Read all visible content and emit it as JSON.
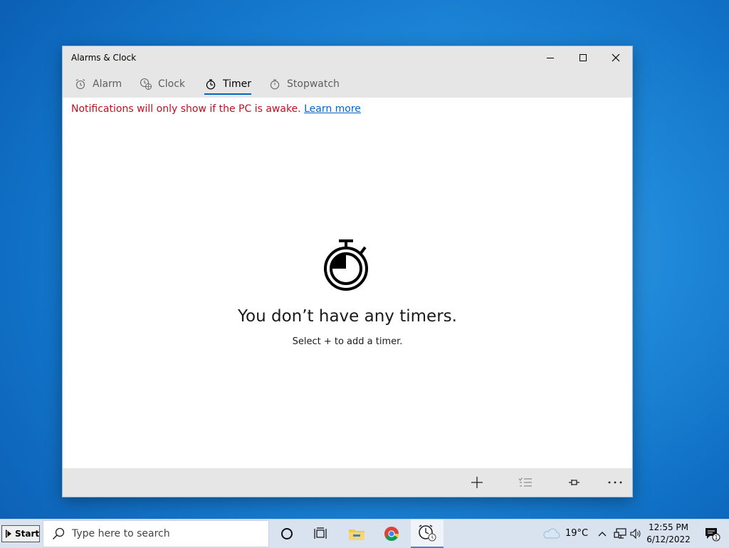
{
  "window": {
    "title": "Alarms & Clock"
  },
  "tabs": [
    {
      "label": "Alarm",
      "icon": "alarm-icon",
      "active": false
    },
    {
      "label": "Clock",
      "icon": "clock-icon",
      "active": false
    },
    {
      "label": "Timer",
      "icon": "timer-icon",
      "active": true
    },
    {
      "label": "Stopwatch",
      "icon": "stopwatch-icon",
      "active": false
    }
  ],
  "notice": {
    "text": "Notifications will only show if the PC is awake.",
    "link": "Learn more"
  },
  "empty_state": {
    "title": "You don’t have any timers.",
    "subtitle": "Select + to add a timer."
  },
  "command_bar": {
    "icons": [
      "add-icon",
      "edit-list-icon",
      "pin-icon",
      "more-icon"
    ]
  },
  "taskbar": {
    "start_label": "Start",
    "search_placeholder": "Type here to search",
    "weather": "19°C",
    "time": "12:55 PM",
    "date": "6/12/2022",
    "notification_count": "1"
  },
  "colors": {
    "accent": "#0067c0",
    "notice_red": "#c0101f",
    "link_blue": "#0066cc",
    "chrome_gray": "#e6e6e6"
  }
}
